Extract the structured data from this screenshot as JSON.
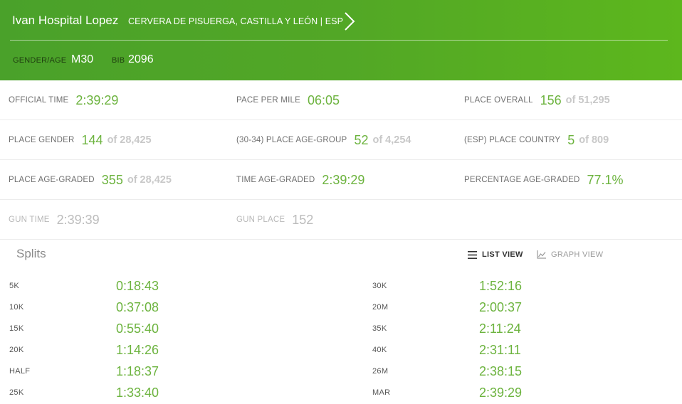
{
  "header": {
    "name": "Ivan Hospital Lopez",
    "location": "CERVERA DE PISUERGA, CASTILLA Y LEÓN | ESP",
    "gender_age_label": "GENDER/AGE",
    "gender_age_value": "M30",
    "bib_label": "BIB",
    "bib_value": "2096"
  },
  "stats": [
    [
      {
        "label": "OFFICIAL TIME",
        "value": "2:39:29",
        "of": ""
      },
      {
        "label": "PACE PER MILE",
        "value": "06:05",
        "of": ""
      },
      {
        "label": "PLACE OVERALL",
        "value": "156",
        "of": "of 51,295"
      }
    ],
    [
      {
        "label": "PLACE GENDER",
        "value": "144",
        "of": "of 28,425"
      },
      {
        "label": "(30-34) PLACE AGE-GROUP",
        "value": "52",
        "of": "of 4,254"
      },
      {
        "label": "(ESP) PLACE COUNTRY",
        "value": "5",
        "of": "of 809"
      }
    ],
    [
      {
        "label": "PLACE AGE-GRADED",
        "value": "355",
        "of": "of 28,425"
      },
      {
        "label": "TIME AGE-GRADED",
        "value": "2:39:29",
        "of": ""
      },
      {
        "label": "PERCENTAGE AGE-GRADED",
        "value": "77.1%",
        "of": ""
      }
    ],
    [
      {
        "label": "GUN TIME",
        "value": "2:39:39",
        "of": ""
      },
      {
        "label": "GUN PLACE",
        "value": "152",
        "of": ""
      }
    ]
  ],
  "splits": {
    "title": "Splits",
    "list_view_label": "LIST VIEW",
    "graph_view_label": "GRAPH VIEW",
    "left": [
      {
        "label": "5K",
        "time": "0:18:43"
      },
      {
        "label": "10K",
        "time": "0:37:08"
      },
      {
        "label": "15K",
        "time": "0:55:40"
      },
      {
        "label": "20K",
        "time": "1:14:26"
      },
      {
        "label": "HALF",
        "time": "1:18:37"
      },
      {
        "label": "25K",
        "time": "1:33:40"
      }
    ],
    "right": [
      {
        "label": "30K",
        "time": "1:52:16"
      },
      {
        "label": "20M",
        "time": "2:00:37"
      },
      {
        "label": "35K",
        "time": "2:11:24"
      },
      {
        "label": "40K",
        "time": "2:31:11"
      },
      {
        "label": "26M",
        "time": "2:38:15"
      },
      {
        "label": "MAR",
        "time": "2:39:29"
      }
    ]
  },
  "colors": {
    "header_green": "#52a726",
    "value_green": "#6cb33e",
    "muted_gray": "#bcbcbc"
  },
  "icons": {
    "next": "chevron-right-icon",
    "list": "list-icon",
    "graph": "line-chart-icon"
  }
}
